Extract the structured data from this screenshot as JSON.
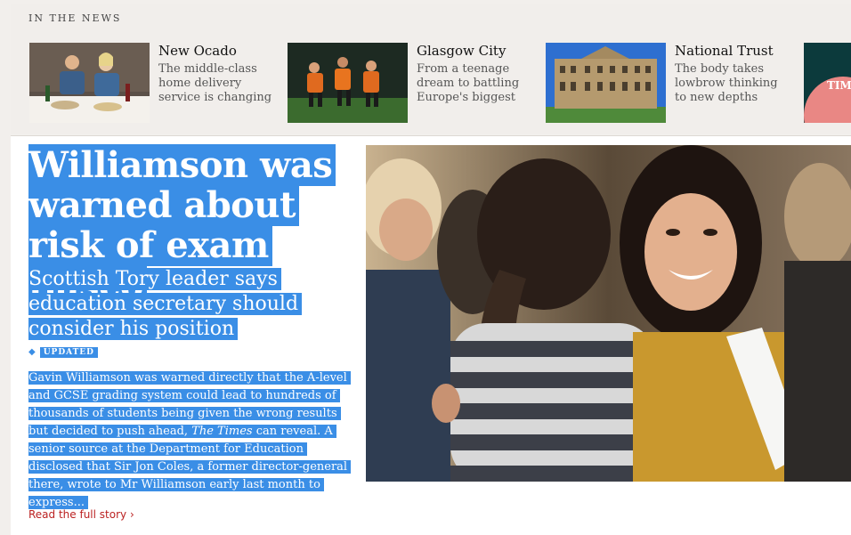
{
  "news": {
    "heading": "IN THE NEWS",
    "cards": [
      {
        "title": "New Ocado",
        "desc": "The middle-class home delivery service is changing"
      },
      {
        "title": "Glasgow City",
        "desc": "From a teenage dream to battling Europe's biggest"
      },
      {
        "title": "National Trust",
        "desc": "The body takes lowbrow thinking to new depths"
      }
    ],
    "partial_thumb_text": "TIM"
  },
  "article": {
    "headline": "Williamson was warned about risk of exam fiasco",
    "standfirst": "Scottish Tory leader says education secretary should consider his position",
    "badge": "UPDATED",
    "body_before": "Gavin Williamson was warned directly that the A-level and GCSE grading system could lead to hundreds of thousands of students being given the wrong results but decided to push ahead, ",
    "body_italic": "The Times",
    "body_after": " can reveal. A senior source at the Department for Education disclosed that Sir Jon Coles, a former director-general there, wrote to Mr Williamson early last month to express...",
    "read_more": "Read the full story",
    "read_more_arrow": "›"
  },
  "colors": {
    "selection": "#3a8ee6",
    "link": "#bb2222",
    "background": "#f2efec"
  }
}
